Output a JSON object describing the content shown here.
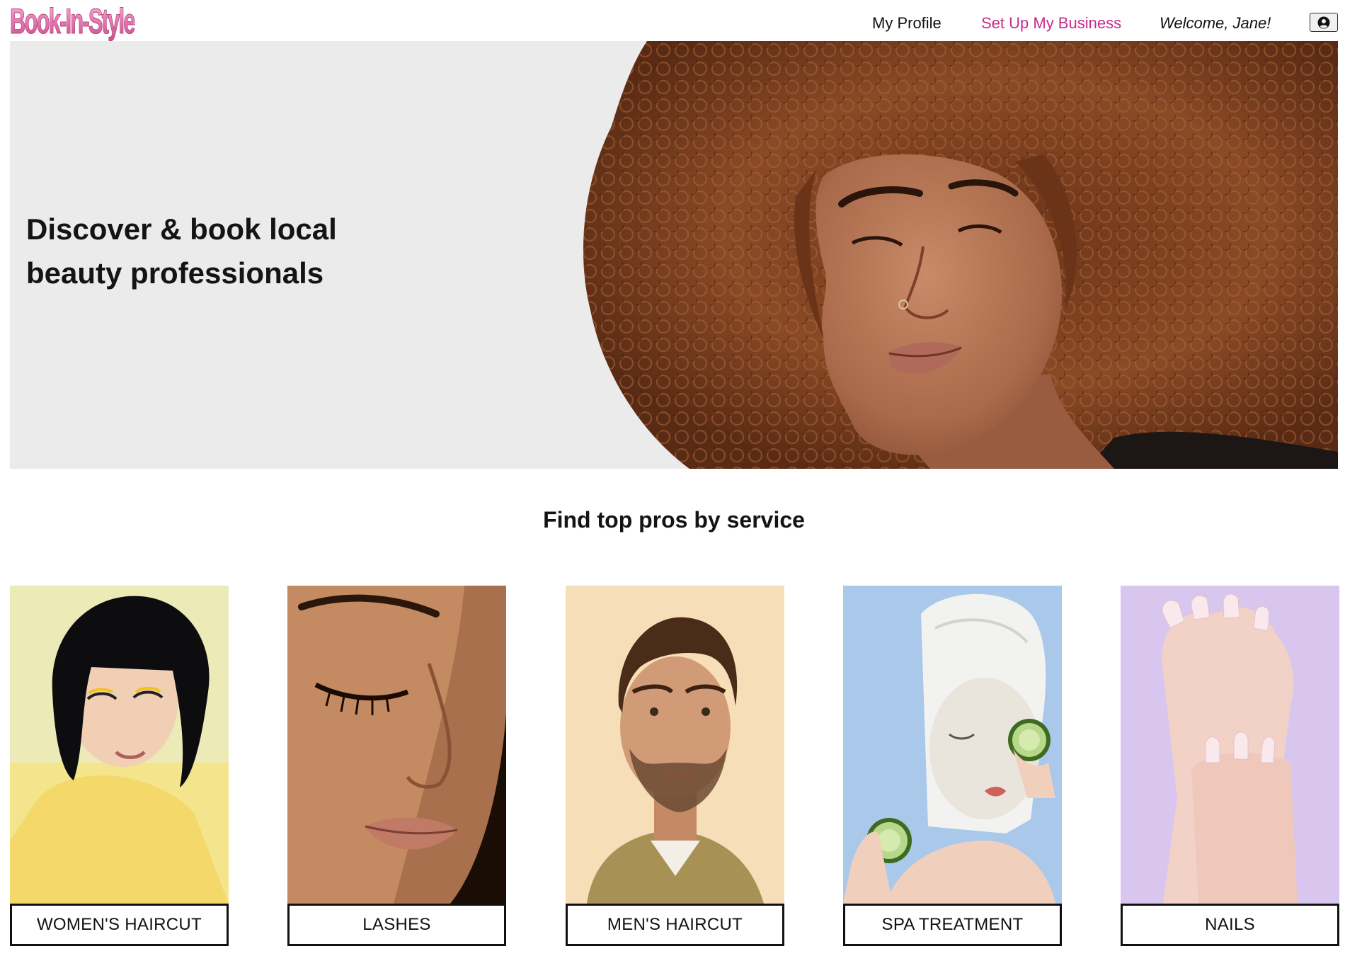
{
  "header": {
    "logo": "Book-In-Style",
    "nav": {
      "my_profile": "My Profile",
      "set_up_business": "Set Up My Business",
      "welcome": "Welcome, Jane!"
    },
    "account_icon": "user-circle-icon"
  },
  "hero": {
    "title_line1": "Discover & book local",
    "title_line2": "beauty professionals"
  },
  "services": {
    "heading": "Find top pros by service",
    "items": [
      {
        "label": "WOMEN'S HAIRCUT"
      },
      {
        "label": "LASHES"
      },
      {
        "label": "MEN'S HAIRCUT"
      },
      {
        "label": "SPA TREATMENT"
      },
      {
        "label": "NAILS"
      }
    ]
  },
  "colors": {
    "accent": "#c92b8a",
    "logo_pink": "#e57fb4",
    "hero_bg": "#ebebeb",
    "text": "#141414"
  }
}
